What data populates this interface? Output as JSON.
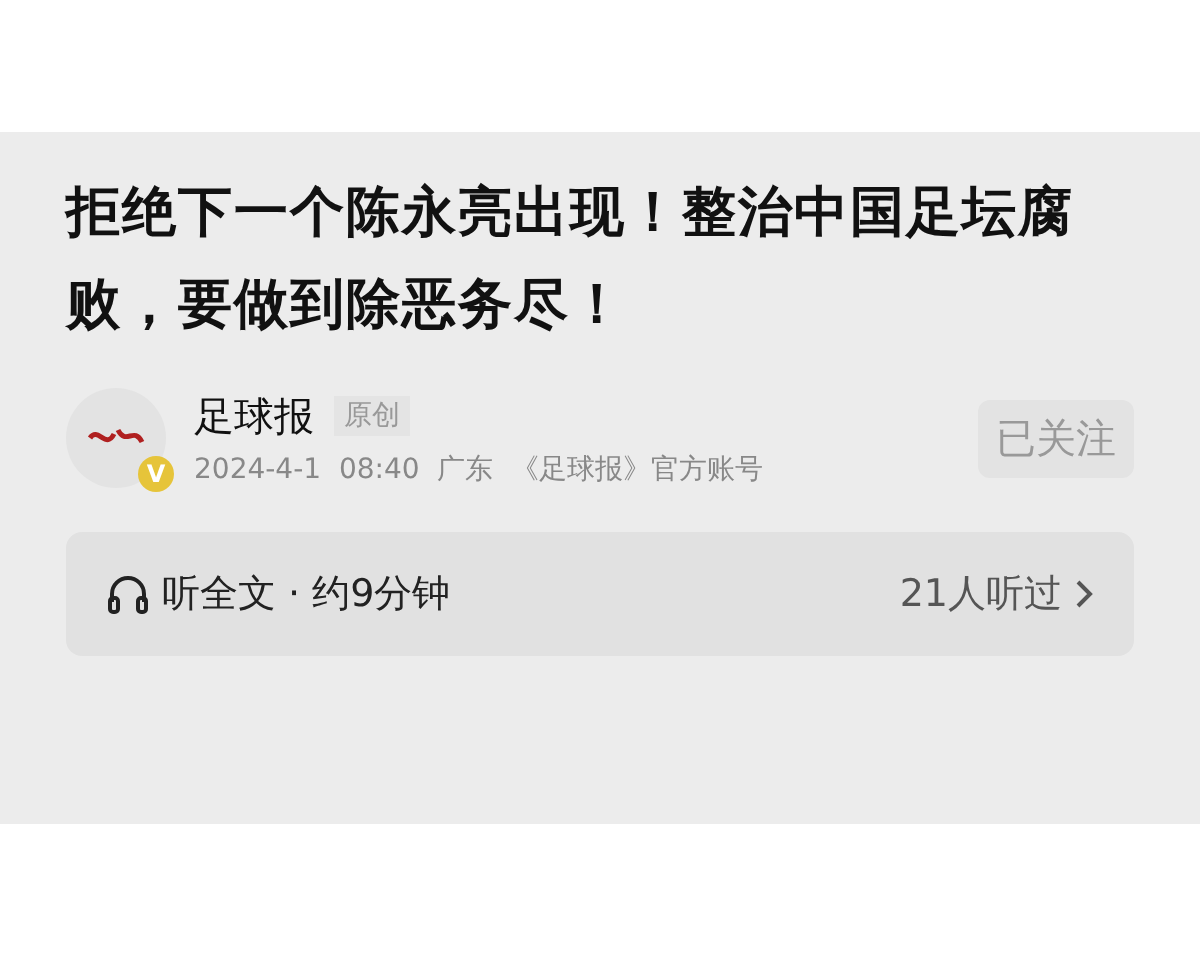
{
  "article": {
    "title": "拒绝下一个陈永亮出现！整治中国足坛腐败，要做到除恶务尽！",
    "author": {
      "name": "足球报",
      "verified_badge": "V",
      "tag": "原创",
      "meta": "2024-4-1  08:40  广东  《足球报》官方账号"
    },
    "follow_button": {
      "label": "已关注",
      "followed": true
    },
    "listen_bar": {
      "label": "听全文 · 约9分钟",
      "listeners": "21人听过"
    }
  }
}
